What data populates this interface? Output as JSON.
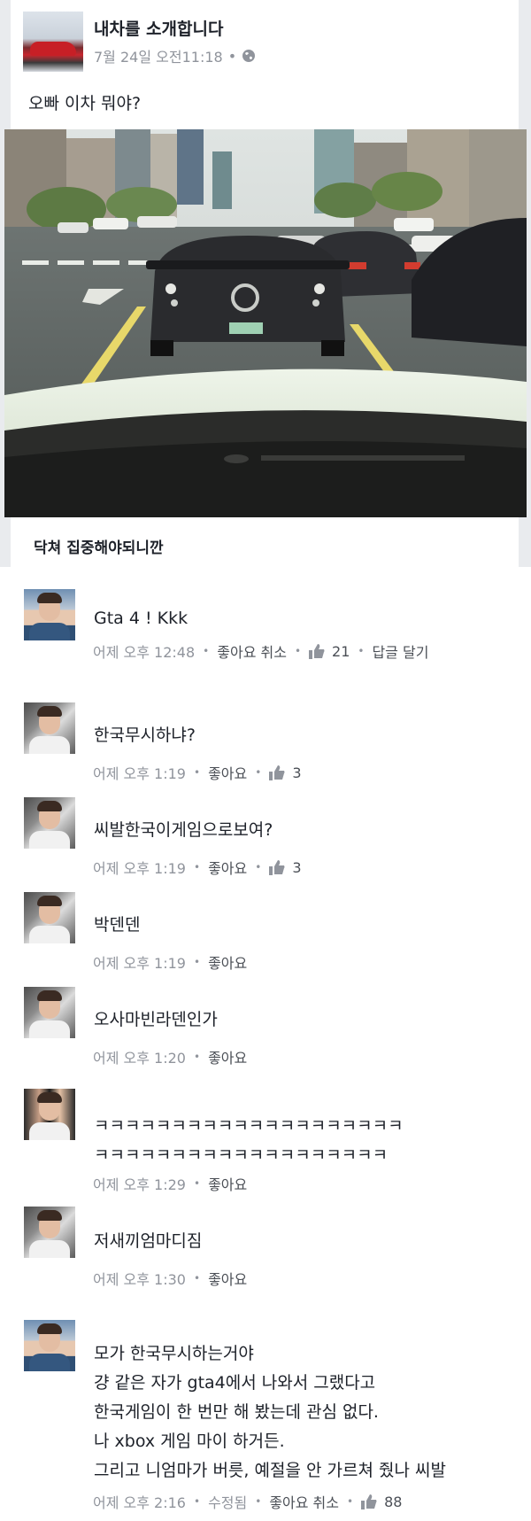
{
  "post": {
    "title": "내차를 소개합니다",
    "time": "7월 24일 오전11:18",
    "separator": "•",
    "text": "오빠 이차 뭐야?",
    "caption": "닥쳐 집중해야되니깐"
  },
  "comments": [
    {
      "avatar": "user-a",
      "text": "Gta 4 ! Kkk",
      "meta": [
        "어제 오후 12:48",
        "좋아요 취소"
      ],
      "likes": "21",
      "reply": "답글 달기"
    },
    {
      "avatar": "user-b",
      "text": "한국무시하냐?",
      "meta": [
        "어제 오후 1:19",
        "좋아요"
      ],
      "likes": "3"
    },
    {
      "avatar": "user-b",
      "text": "씨발한국이게임으로보여?",
      "meta": [
        "어제 오후 1:19",
        "좋아요"
      ],
      "likes": "3"
    },
    {
      "avatar": "user-b",
      "text": "박덴덴",
      "meta": [
        "어제 오후 1:19",
        "좋아요"
      ]
    },
    {
      "avatar": "user-b",
      "text": "오사마빈라덴인가",
      "meta": [
        "어제 오후 1:20",
        "좋아요"
      ]
    },
    {
      "avatar": "user-c",
      "text": "ㅋㅋㅋㅋㅋㅋㅋㅋㅋㅋㅋㅋㅋㅋㅋㅋㅋㅋㅋㅋ\nㅋㅋㅋㅋㅋㅋㅋㅋㅋㅋㅋㅋㅋㅋㅋㅋㅋㅋㅋ",
      "meta": [
        "어제 오후 1:29",
        "좋아요"
      ]
    },
    {
      "avatar": "user-b",
      "text": "저새끼엄마디짐",
      "meta": [
        "어제 오후 1:30",
        "좋아요"
      ]
    },
    {
      "avatar": "user-a",
      "text": "모가 한국무시하는거야\n걍 같은 자가 gta4에서 나와서 그랬다고\n한국게임이 한 번만 해 봤는데 관심 없다.\n나 xbox 게임 마이 하거든.\n그리고 니엄마가 버릇, 예절을 안 가르쳐 줬나 씨발",
      "meta": [
        "어제 오후 2:16",
        "수정됨",
        "좋아요 취소"
      ],
      "likes": "88"
    }
  ],
  "icons": {
    "globe": "globe-icon",
    "thumb": "thumbs-up-icon"
  },
  "colors": {
    "meta_gray": "#90949c",
    "link_gray": "#4b4f56",
    "feed_bg": "#e9ebee"
  }
}
